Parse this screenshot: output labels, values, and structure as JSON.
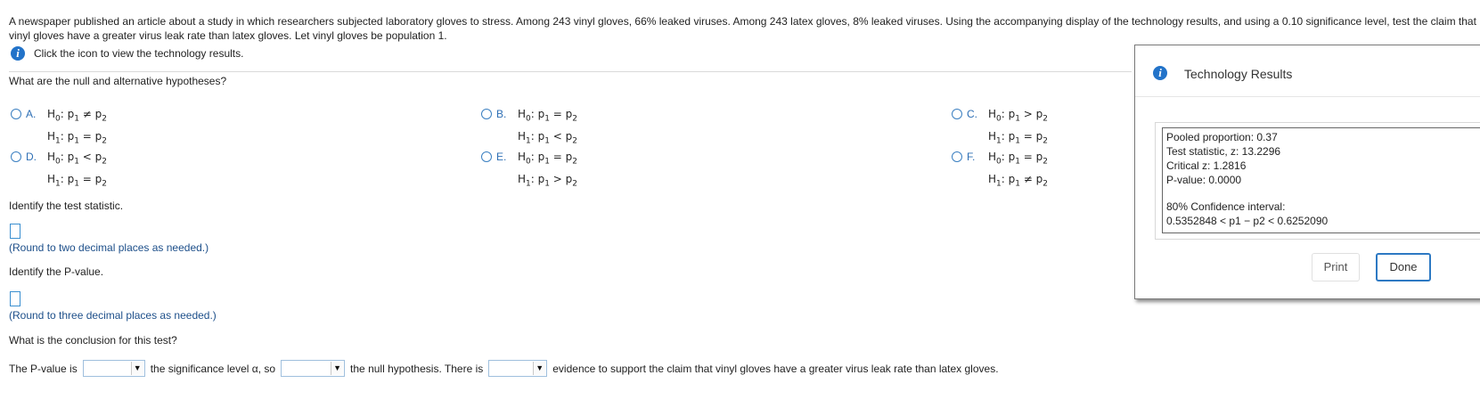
{
  "problem": {
    "text": "A newspaper published an article about a study in which researchers subjected laboratory gloves to stress. Among 243 vinyl gloves, 66% leaked viruses. Among 243 latex gloves, 8% leaked viruses. Using the accompanying display of the technology results, and using a 0.10 significance level, test the claim that vinyl gloves have a greater virus leak rate than latex gloves. Let vinyl gloves be population 1."
  },
  "tech_link": {
    "icon": "info-icon",
    "label": "Click the icon to view the technology results."
  },
  "q1": {
    "prompt": "What are the null and alternative hypotheses?",
    "options": [
      {
        "letter": "A.",
        "h0": "H0: p1 ≠ p2",
        "h1": "H1: p1 = p2"
      },
      {
        "letter": "B.",
        "h0": "H0: p1 = p2",
        "h1": "H1: p1 < p2"
      },
      {
        "letter": "C.",
        "h0": "H0: p1 > p2",
        "h1": "H1: p1 = p2"
      },
      {
        "letter": "D.",
        "h0": "H0: p1 < p2",
        "h1": "H1: p1 = p2"
      },
      {
        "letter": "E.",
        "h0": "H0: p1 = p2",
        "h1": "H1: p1 > p2"
      },
      {
        "letter": "F.",
        "h0": "H0: p1 = p2",
        "h1": "H1: p1 ≠ p2"
      }
    ]
  },
  "q2": {
    "prompt": "Identify the test statistic.",
    "hint": "(Round to two decimal places as needed.)"
  },
  "q3": {
    "prompt": "Identify the P-value.",
    "hint": "(Round to three decimal places as needed.)"
  },
  "q4": {
    "prompt": "What is the conclusion for this test?",
    "part1": "The P-value is",
    "part2": "the significance level α, so",
    "part3": "the null hypothesis. There is",
    "part4": "evidence to support the claim that vinyl gloves have a greater virus leak rate than latex gloves."
  },
  "dialog": {
    "title": "Technology Results",
    "lines": [
      "Pooled proportion: 0.37",
      "Test statistic, z: 13.2296",
      "Critical z: 1.2816",
      "P-value: 0.0000",
      "",
      "80% Confidence interval:",
      "0.5352848 < p1 − p2 < 0.6252090"
    ],
    "print_label": "Print",
    "done_label": "Done"
  }
}
